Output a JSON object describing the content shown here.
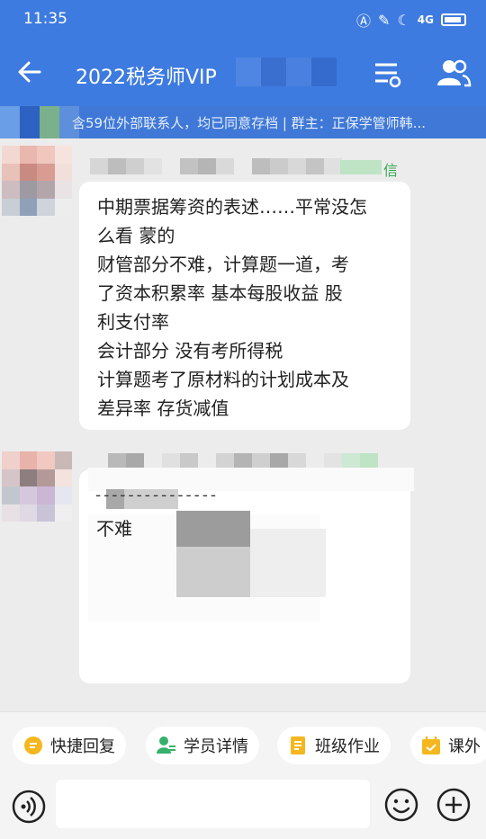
{
  "status_bar": {
    "time": "11:35",
    "signal": "4G"
  },
  "header": {
    "title": "2022税务师VIP"
  },
  "notice": {
    "text": "含59位外部联系人，均已同意存档 | 群主：正保学管师韩..."
  },
  "sender1": {
    "tag": "信"
  },
  "message1": {
    "lines": [
      "中期票据筹资的表述……平常没怎",
      "么看 蒙的",
      "财管部分不难，计算题一道，考",
      "了资本积累率 基本每股收益  股",
      "利支付率",
      "会计部分 没有考所得税",
      "计算题考了原材料的计划成本及",
      "差异率 存货减值"
    ]
  },
  "message2": {
    "divider": "---------------",
    "text": "不难"
  },
  "quick_replies": [
    {
      "label": "快捷回复",
      "icon": "quick-reply-icon",
      "color": "#f5b71e"
    },
    {
      "label": "学员详情",
      "icon": "student-detail-icon",
      "color": "#35b16a"
    },
    {
      "label": "班级作业",
      "icon": "class-homework-icon",
      "color": "#f5b71e"
    },
    {
      "label": "课外",
      "icon": "extracurricular-icon",
      "color": "#f5b71e"
    }
  ],
  "input": {
    "placeholder": ""
  },
  "colors": {
    "primary": "#3e7be0",
    "notice": "#3f78d6",
    "chat_bg": "#ececec"
  }
}
